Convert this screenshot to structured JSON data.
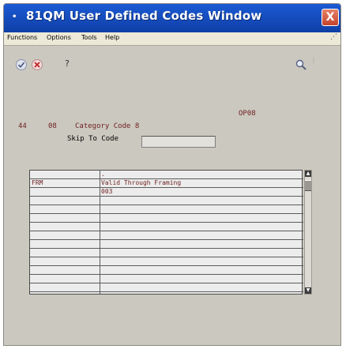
{
  "window": {
    "title": "81QM  User Defined Codes Window",
    "close_glyph": "X",
    "title_icon": "•"
  },
  "menu": {
    "items": [
      "Functions",
      "Options",
      "Tools",
      "Help"
    ],
    "right_glyph": "⋰"
  },
  "toolbar": {
    "ok_icon": "check-icon",
    "cancel_icon": "cancel-icon",
    "help_label": "?",
    "search_icon": "search-icon"
  },
  "form": {
    "system_code": "OP08",
    "product_code": "44",
    "code_type": "08",
    "code_desc": "Category Code 8",
    "skip_to_code_label": "Skip To Code",
    "skip_to_code_value": ""
  },
  "grid": {
    "rows": [
      {
        "code": "",
        "description": "."
      },
      {
        "code": "FRM",
        "description": "Valid Through Framing"
      },
      {
        "code": "",
        "description": "003"
      },
      {
        "code": "",
        "description": ""
      },
      {
        "code": "",
        "description": ""
      },
      {
        "code": "",
        "description": ""
      },
      {
        "code": "",
        "description": ""
      },
      {
        "code": "",
        "description": ""
      },
      {
        "code": "",
        "description": ""
      },
      {
        "code": "",
        "description": ""
      },
      {
        "code": "",
        "description": ""
      },
      {
        "code": "",
        "description": ""
      },
      {
        "code": "",
        "description": ""
      },
      {
        "code": "",
        "description": ""
      }
    ]
  },
  "colors": {
    "title_bar": "#1b5ad4",
    "form_label": "#6d1f1f",
    "background": "#cbc8bf"
  }
}
